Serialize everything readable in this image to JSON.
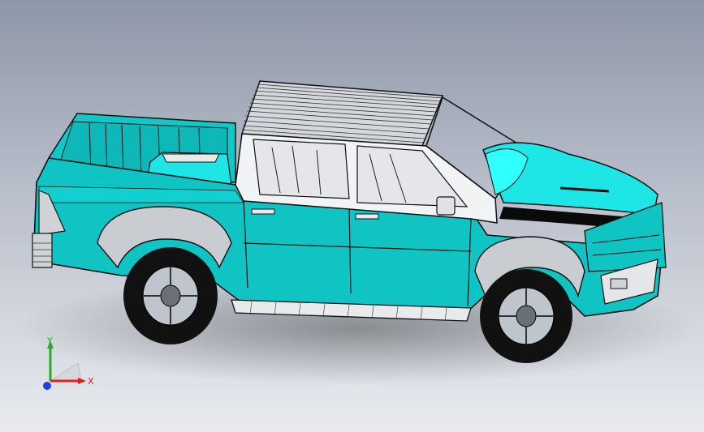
{
  "viewport": {
    "background_top": "#8e97a8",
    "background_bottom": "#e9ebef"
  },
  "model": {
    "body_color": "#10c4c4",
    "body_dark": "#0aa7a7",
    "hood_color": "#1ee6e6",
    "trim_color": "#c9cdd1",
    "outline": "#0b0b0b",
    "tire_color": "#111111",
    "rim_color": "#bfc5cc"
  },
  "triad": {
    "x_label": "X",
    "y_label": "Y",
    "x_color": "#e02020",
    "y_color": "#20b020",
    "z_color": "#2040e0"
  }
}
